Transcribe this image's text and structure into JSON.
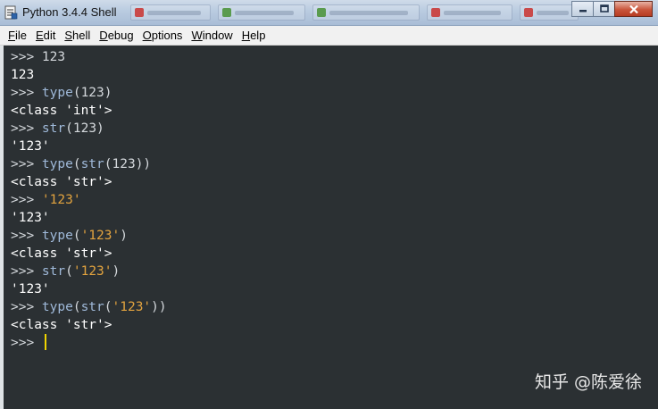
{
  "window": {
    "title": "Python 3.4.4 Shell"
  },
  "menu": [
    {
      "label": "File",
      "ul": "F",
      "rest": "ile"
    },
    {
      "label": "Edit",
      "ul": "E",
      "rest": "dit"
    },
    {
      "label": "Shell",
      "ul": "S",
      "rest": "hell"
    },
    {
      "label": "Debug",
      "ul": "D",
      "rest": "ebug"
    },
    {
      "label": "Options",
      "ul": "O",
      "rest": "ptions"
    },
    {
      "label": "Window",
      "ul": "W",
      "rest": "indow"
    },
    {
      "label": "Help",
      "ul": "H",
      "rest": "elp"
    }
  ],
  "shell": {
    "prompt": ">>> ",
    "lines": [
      {
        "kind": "input",
        "parts": [
          {
            "t": "123",
            "c": "plain"
          }
        ]
      },
      {
        "kind": "output",
        "text": "123"
      },
      {
        "kind": "input",
        "parts": [
          {
            "t": "type",
            "c": "kw"
          },
          {
            "t": "(123)",
            "c": "plain"
          }
        ]
      },
      {
        "kind": "output",
        "text": "<class 'int'>"
      },
      {
        "kind": "input",
        "parts": [
          {
            "t": "str",
            "c": "kw"
          },
          {
            "t": "(123)",
            "c": "plain"
          }
        ]
      },
      {
        "kind": "output",
        "text": "'123'"
      },
      {
        "kind": "input",
        "parts": [
          {
            "t": "type",
            "c": "kw"
          },
          {
            "t": "(",
            "c": "plain"
          },
          {
            "t": "str",
            "c": "kw"
          },
          {
            "t": "(123))",
            "c": "plain"
          }
        ]
      },
      {
        "kind": "output",
        "text": "<class 'str'>"
      },
      {
        "kind": "input",
        "parts": [
          {
            "t": "'123'",
            "c": "str"
          }
        ]
      },
      {
        "kind": "output",
        "text": "'123'"
      },
      {
        "kind": "input",
        "parts": [
          {
            "t": "type",
            "c": "kw"
          },
          {
            "t": "(",
            "c": "plain"
          },
          {
            "t": "'123'",
            "c": "str"
          },
          {
            "t": ")",
            "c": "plain"
          }
        ]
      },
      {
        "kind": "output",
        "text": "<class 'str'>"
      },
      {
        "kind": "input",
        "parts": [
          {
            "t": "str",
            "c": "kw"
          },
          {
            "t": "(",
            "c": "plain"
          },
          {
            "t": "'123'",
            "c": "str"
          },
          {
            "t": ")",
            "c": "plain"
          }
        ]
      },
      {
        "kind": "output",
        "text": "'123'"
      },
      {
        "kind": "input",
        "parts": [
          {
            "t": "type",
            "c": "kw"
          },
          {
            "t": "(",
            "c": "plain"
          },
          {
            "t": "str",
            "c": "kw"
          },
          {
            "t": "(",
            "c": "plain"
          },
          {
            "t": "'123'",
            "c": "str"
          },
          {
            "t": "))",
            "c": "plain"
          }
        ]
      },
      {
        "kind": "output",
        "text": "<class 'str'>"
      },
      {
        "kind": "current",
        "parts": []
      }
    ]
  },
  "watermark": "知乎 @陈爱徐",
  "colors": {
    "background": "#2b3033",
    "keyword": "#9fb9d9",
    "string": "#e2a33f",
    "text": "#d4d8dc",
    "cursor": "#f0d400"
  },
  "icons": {
    "app": "python-idle-icon",
    "minimize": "minimize-icon",
    "maximize": "maximize-icon",
    "close": "close-icon"
  }
}
